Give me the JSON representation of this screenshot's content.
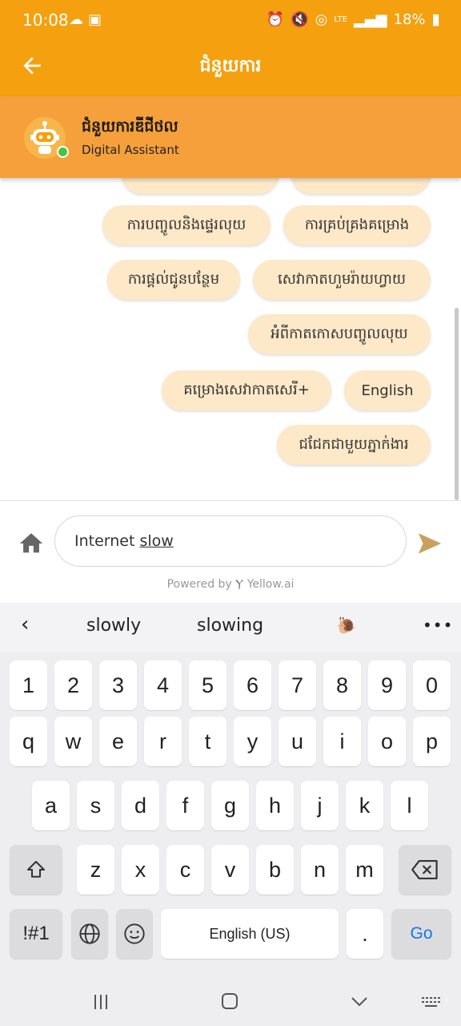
{
  "status": {
    "time": "10:08",
    "battery": "18%",
    "lte": "LTE"
  },
  "header": {
    "title": "ជំនួយការ"
  },
  "bot": {
    "name": "ជំនួយការឌីជីថល",
    "subtitle": "Digital Assistant"
  },
  "chips": [
    {
      "label": "ការបញ្ចូលនិងផ្ទេរលុយ"
    },
    {
      "label": "ការគ្រប់គ្រងគម្រោង"
    },
    {
      "label": "ការផ្តល់ជូនបន្ថែម"
    },
    {
      "label": "សេវាកាតហួមរ៉ាយហ្វាយ"
    },
    {
      "label": "អំពីកាតកោសបញ្ចូលលុយ"
    },
    {
      "label": "គម្រោងសេវាកាតសេរី+"
    },
    {
      "label": "English"
    },
    {
      "label": "ជជែកជាមួយភ្នាក់ងារ"
    }
  ],
  "input": {
    "word1": "Internet ",
    "word2": "slow"
  },
  "powered_by": {
    "prefix": "Powered by",
    "brand": "Yellow.ai"
  },
  "keyboard": {
    "suggestions": [
      "slowly",
      "slowing",
      "🐌"
    ],
    "row_numbers": [
      "1",
      "2",
      "3",
      "4",
      "5",
      "6",
      "7",
      "8",
      "9",
      "0"
    ],
    "row_q": [
      "q",
      "w",
      "e",
      "r",
      "t",
      "y",
      "u",
      "i",
      "o",
      "p"
    ],
    "row_a": [
      "a",
      "s",
      "d",
      "f",
      "g",
      "h",
      "j",
      "k",
      "l"
    ],
    "row_z": [
      "z",
      "x",
      "c",
      "v",
      "b",
      "n",
      "m"
    ],
    "symbols_label": "!#1",
    "space_label": "English (US)",
    "period_label": ".",
    "go_label": "Go"
  }
}
